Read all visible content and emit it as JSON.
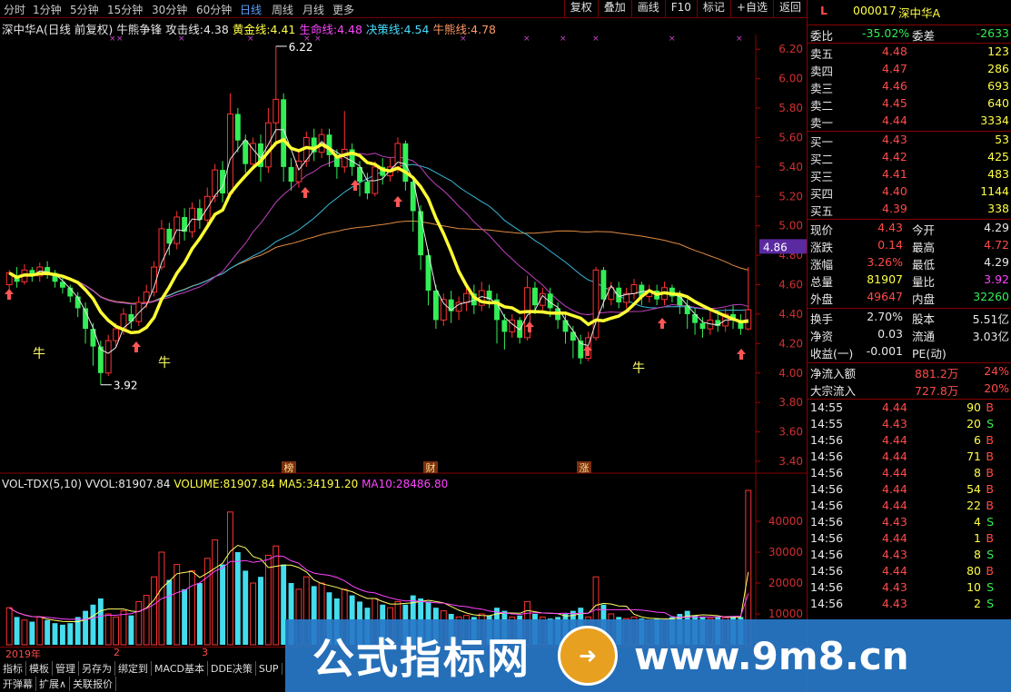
{
  "periods": [
    "分时",
    "1分钟",
    "5分钟",
    "15分钟",
    "30分钟",
    "60分钟",
    "日线",
    "周线",
    "月线",
    "更多"
  ],
  "active_period": "日线",
  "toolbar": [
    "复权",
    "叠加",
    "画线",
    "F10",
    "标记",
    "+自选",
    "返回"
  ],
  "info": {
    "stock": "深中华A(日线 前复权)",
    "indicator": "牛熊争锋",
    "attack_label": "攻击线:",
    "attack": "4.38",
    "gold_label": "黄金线:",
    "gold": "4.41",
    "life_label": "生命线:",
    "life": "4.48",
    "decide_label": "决策线:",
    "decide": "4.54",
    "bear_label": "牛熊线:",
    "bear": "4.78"
  },
  "y_labels": [
    "6.20",
    "6.00",
    "5.80",
    "5.60",
    "5.40",
    "5.20",
    "5.00",
    "4.80",
    "4.60",
    "4.40",
    "4.20",
    "4.00",
    "3.80",
    "3.60",
    "3.40"
  ],
  "price_tag": "4.86",
  "annotations": {
    "high": "6.22",
    "low": "3.92",
    "bull": "牛",
    "bang": "榜",
    "cai": "财",
    "zhang": "涨"
  },
  "vol_info": {
    "name": "VOL-TDX(5,10)",
    "vvol_label": "VVOL:",
    "vvol": "81907.84",
    "volume_label": "VOLUME:",
    "volume": "81907.84",
    "ma5_label": "MA5:",
    "ma5": "34191.20",
    "ma10_label": "MA10:",
    "ma10": "28486.80"
  },
  "vol_y_labels": [
    "40000",
    "30000",
    "20000",
    "10000"
  ],
  "date_labels": [
    "2019年",
    "2",
    "3"
  ],
  "bottom_tabs": [
    "指标",
    "模板",
    "管理",
    "另存为",
    "绑定到",
    "MACD基本",
    "DDE决策",
    "SUP"
  ],
  "bottom_tabs2": [
    "开弹幕",
    "扩展∧",
    "关联报价"
  ],
  "colors": {
    "accent_red": "#ff4a4a",
    "green": "#33ee55",
    "yellow": "#ffff44"
  },
  "panel": {
    "code_letter": "L",
    "code": "000017",
    "name": "深中华A",
    "weibi_label": "委比",
    "weibi": "-35.02%",
    "weicha_label": "委差",
    "weicha": "-2633",
    "sells": [
      {
        "label": "卖五",
        "price": "4.48",
        "vol": "123"
      },
      {
        "label": "卖四",
        "price": "4.47",
        "vol": "286"
      },
      {
        "label": "卖三",
        "price": "4.46",
        "vol": "693"
      },
      {
        "label": "卖二",
        "price": "4.45",
        "vol": "640"
      },
      {
        "label": "卖一",
        "price": "4.44",
        "vol": "3334"
      }
    ],
    "buys": [
      {
        "label": "买一",
        "price": "4.43",
        "vol": "53"
      },
      {
        "label": "买二",
        "price": "4.42",
        "vol": "425"
      },
      {
        "label": "买三",
        "price": "4.41",
        "vol": "483"
      },
      {
        "label": "买四",
        "price": "4.40",
        "vol": "1144"
      },
      {
        "label": "买五",
        "price": "4.39",
        "vol": "338"
      }
    ],
    "quote": [
      {
        "l1": "现价",
        "v1": "4.43",
        "c1": "red",
        "l2": "今开",
        "v2": "4.29",
        "c2": "white"
      },
      {
        "l1": "涨跌",
        "v1": "0.14",
        "c1": "red",
        "l2": "最高",
        "v2": "4.72",
        "c2": "red"
      },
      {
        "l1": "涨幅",
        "v1": "3.26%",
        "c1": "red",
        "l2": "最低",
        "v2": "4.29",
        "c2": "white"
      },
      {
        "l1": "总量",
        "v1": "81907",
        "c1": "yellow",
        "l2": "量比",
        "v2": "3.92",
        "c2": "mag"
      },
      {
        "l1": "外盘",
        "v1": "49647",
        "c1": "red",
        "l2": "内盘",
        "v2": "32260",
        "c2": "green"
      }
    ],
    "stats": [
      {
        "l1": "换手",
        "v1": "2.70%",
        "l2": "股本",
        "v2": "5.51亿"
      },
      {
        "l1": "净资",
        "v1": "0.03",
        "l2": "流通",
        "v2": "3.03亿"
      },
      {
        "l1": "收益(一)",
        "v1": "-0.001",
        "l2": "PE(动)",
        "v2": ""
      }
    ],
    "flows": [
      {
        "label": "净流入额",
        "value": "881.2万",
        "pct": "24%"
      },
      {
        "label": "大宗流入",
        "value": "727.8万",
        "pct": "20%"
      }
    ],
    "ticks": [
      {
        "t": "14:55",
        "p": "4.44",
        "v": "90",
        "s": "B",
        "pc": "red"
      },
      {
        "t": "14:55",
        "p": "4.43",
        "v": "20",
        "s": "S",
        "pc": "red"
      },
      {
        "t": "14:56",
        "p": "4.44",
        "v": "6",
        "s": "B",
        "pc": "red"
      },
      {
        "t": "14:56",
        "p": "4.44",
        "v": "71",
        "s": "B",
        "pc": "red"
      },
      {
        "t": "14:56",
        "p": "4.44",
        "v": "8",
        "s": "B",
        "pc": "red"
      },
      {
        "t": "14:56",
        "p": "4.44",
        "v": "54",
        "s": "B",
        "pc": "red"
      },
      {
        "t": "14:56",
        "p": "4.44",
        "v": "22",
        "s": "B",
        "pc": "red"
      },
      {
        "t": "14:56",
        "p": "4.43",
        "v": "4",
        "s": "S",
        "pc": "red"
      },
      {
        "t": "14:56",
        "p": "4.44",
        "v": "1",
        "s": "B",
        "pc": "red"
      },
      {
        "t": "14:56",
        "p": "4.43",
        "v": "8",
        "s": "S",
        "pc": "red"
      },
      {
        "t": "14:56",
        "p": "4.44",
        "v": "80",
        "s": "B",
        "pc": "red"
      },
      {
        "t": "14:56",
        "p": "4.43",
        "v": "10",
        "s": "S",
        "pc": "red"
      },
      {
        "t": "14:56",
        "p": "4.43",
        "v": "2",
        "s": "S",
        "pc": "red"
      }
    ]
  },
  "watermark": {
    "text": "公式指标网",
    "url": "www.9m8.cn"
  },
  "chart_data": {
    "type": "candlestick",
    "ylim": [
      3.4,
      6.3
    ],
    "candles": [
      [
        4.6,
        4.68,
        4.55,
        4.7
      ],
      [
        4.66,
        4.62,
        4.58,
        4.72
      ],
      [
        4.62,
        4.7,
        4.6,
        4.74
      ],
      [
        4.7,
        4.66,
        4.62,
        4.72
      ],
      [
        4.66,
        4.72,
        4.62,
        4.75
      ],
      [
        4.72,
        4.68,
        4.64,
        4.76
      ],
      [
        4.68,
        4.62,
        4.58,
        4.7
      ],
      [
        4.62,
        4.58,
        4.54,
        4.66
      ],
      [
        4.58,
        4.52,
        4.48,
        4.6
      ],
      [
        4.52,
        4.44,
        4.38,
        4.55
      ],
      [
        4.44,
        4.3,
        4.2,
        4.48
      ],
      [
        4.3,
        4.18,
        4.05,
        4.34
      ],
      [
        4.18,
        4.0,
        3.92,
        4.22
      ],
      [
        4.0,
        4.22,
        3.98,
        4.26
      ],
      [
        4.22,
        4.3,
        4.18,
        4.34
      ],
      [
        4.3,
        4.4,
        4.26,
        4.44
      ],
      [
        4.4,
        4.35,
        4.3,
        4.46
      ],
      [
        4.35,
        4.48,
        4.32,
        4.52
      ],
      [
        4.48,
        4.55,
        4.44,
        4.6
      ],
      [
        4.55,
        4.72,
        4.52,
        4.76
      ],
      [
        4.72,
        4.98,
        4.7,
        5.04
      ],
      [
        4.98,
        4.88,
        4.8,
        5.02
      ],
      [
        4.88,
        5.06,
        4.84,
        5.1
      ],
      [
        5.06,
        4.96,
        4.9,
        5.12
      ],
      [
        4.96,
        5.12,
        4.92,
        5.16
      ],
      [
        5.12,
        5.04,
        4.98,
        5.18
      ],
      [
        5.04,
        5.2,
        5.0,
        5.26
      ],
      [
        5.2,
        5.38,
        5.16,
        5.42
      ],
      [
        5.38,
        5.22,
        5.16,
        5.44
      ],
      [
        5.22,
        5.76,
        5.2,
        5.9
      ],
      [
        5.76,
        5.58,
        5.5,
        5.8
      ],
      [
        5.58,
        5.42,
        5.36,
        5.62
      ],
      [
        5.42,
        5.56,
        5.38,
        5.6
      ],
      [
        5.56,
        5.4,
        5.3,
        5.62
      ],
      [
        5.4,
        5.7,
        5.36,
        5.8
      ],
      [
        5.7,
        5.86,
        5.54,
        6.22
      ],
      [
        5.86,
        5.4,
        5.3,
        5.9
      ],
      [
        5.4,
        5.3,
        5.24,
        5.46
      ],
      [
        5.3,
        5.44,
        5.26,
        5.5
      ],
      [
        5.44,
        5.6,
        5.4,
        5.64
      ],
      [
        5.6,
        5.5,
        5.44,
        5.66
      ],
      [
        5.5,
        5.62,
        5.46,
        5.66
      ],
      [
        5.62,
        5.48,
        5.4,
        5.66
      ],
      [
        5.48,
        5.4,
        5.32,
        5.52
      ],
      [
        5.4,
        5.52,
        5.36,
        5.78
      ],
      [
        5.52,
        5.4,
        5.34,
        5.56
      ],
      [
        5.4,
        5.3,
        5.2,
        5.44
      ],
      [
        5.3,
        5.22,
        5.18,
        5.36
      ],
      [
        5.22,
        5.4,
        5.2,
        5.44
      ],
      [
        5.4,
        5.34,
        5.28,
        5.46
      ],
      [
        5.34,
        5.4,
        5.3,
        5.46
      ],
      [
        5.4,
        5.56,
        5.36,
        5.6
      ],
      [
        5.56,
        5.3,
        5.24,
        5.58
      ],
      [
        5.3,
        5.1,
        4.96,
        5.34
      ],
      [
        5.1,
        4.8,
        4.7,
        5.14
      ],
      [
        4.8,
        4.56,
        4.46,
        4.84
      ],
      [
        4.56,
        4.36,
        4.3,
        4.6
      ],
      [
        4.36,
        4.5,
        4.32,
        4.54
      ],
      [
        4.5,
        4.42,
        4.34,
        4.56
      ],
      [
        4.42,
        4.48,
        4.36,
        4.52
      ],
      [
        4.48,
        4.54,
        4.42,
        4.58
      ],
      [
        4.54,
        4.46,
        4.4,
        4.6
      ],
      [
        4.46,
        4.56,
        4.42,
        4.62
      ],
      [
        4.56,
        4.5,
        4.44,
        4.6
      ],
      [
        4.5,
        4.36,
        4.2,
        4.54
      ],
      [
        4.36,
        4.28,
        4.16,
        4.4
      ],
      [
        4.28,
        4.36,
        4.24,
        4.4
      ],
      [
        4.36,
        4.24,
        4.2,
        4.38
      ],
      [
        4.24,
        4.58,
        4.22,
        4.66
      ],
      [
        4.58,
        4.46,
        4.4,
        4.62
      ],
      [
        4.46,
        4.54,
        4.42,
        4.58
      ],
      [
        4.54,
        4.44,
        4.38,
        4.58
      ],
      [
        4.44,
        4.36,
        4.3,
        4.48
      ],
      [
        4.36,
        4.28,
        4.2,
        4.4
      ],
      [
        4.28,
        4.22,
        4.1,
        4.32
      ],
      [
        4.22,
        4.1,
        4.06,
        4.26
      ],
      [
        4.1,
        4.24,
        4.08,
        4.28
      ],
      [
        4.24,
        4.7,
        4.22,
        4.72
      ],
      [
        4.7,
        4.5,
        4.44,
        4.72
      ],
      [
        4.5,
        4.58,
        4.46,
        4.62
      ],
      [
        4.58,
        4.48,
        4.44,
        4.62
      ],
      [
        4.48,
        4.54,
        4.44,
        4.58
      ],
      [
        4.54,
        4.6,
        4.5,
        4.64
      ],
      [
        4.6,
        4.52,
        4.46,
        4.62
      ],
      [
        4.52,
        4.56,
        4.48,
        4.6
      ],
      [
        4.56,
        4.5,
        4.46,
        4.6
      ],
      [
        4.5,
        4.58,
        4.46,
        4.62
      ],
      [
        4.58,
        4.52,
        4.48,
        4.6
      ],
      [
        4.52,
        4.46,
        4.4,
        4.56
      ],
      [
        4.46,
        4.4,
        4.3,
        4.5
      ],
      [
        4.4,
        4.34,
        4.26,
        4.44
      ],
      [
        4.34,
        4.3,
        4.24,
        4.38
      ],
      [
        4.3,
        4.36,
        4.26,
        4.42
      ],
      [
        4.36,
        4.32,
        4.28,
        4.4
      ],
      [
        4.32,
        4.4,
        4.28,
        4.44
      ],
      [
        4.4,
        4.36,
        4.3,
        4.46
      ],
      [
        4.36,
        4.3,
        4.26,
        4.4
      ],
      [
        4.3,
        4.43,
        4.29,
        4.72
      ]
    ],
    "volumes": [
      12000,
      9000,
      8000,
      7500,
      9000,
      8000,
      7000,
      6500,
      7000,
      9000,
      11000,
      13000,
      15000,
      10000,
      9000,
      11000,
      9500,
      14000,
      16000,
      22000,
      30000,
      21000,
      26000,
      18000,
      24000,
      20000,
      28000,
      34000,
      26000,
      43000,
      30000,
      24000,
      20000,
      22000,
      29000,
      32000,
      26000,
      20000,
      18000,
      22000,
      19000,
      20000,
      17000,
      15000,
      18000,
      16000,
      14000,
      12000,
      15000,
      13000,
      12000,
      14000,
      13000,
      16000,
      15000,
      14000,
      12000,
      11000,
      10000,
      9000,
      9500,
      9000,
      10000,
      9500,
      12000,
      11000,
      9000,
      9500,
      14000,
      10000,
      9000,
      8500,
      9000,
      10000,
      11000,
      12000,
      9000,
      22000,
      13000,
      10000,
      9000,
      8500,
      9000,
      8500,
      8000,
      8500,
      8000,
      9000,
      10000,
      11000,
      9500,
      9000,
      8500,
      9000,
      8800,
      9200,
      9000,
      81907
    ]
  }
}
